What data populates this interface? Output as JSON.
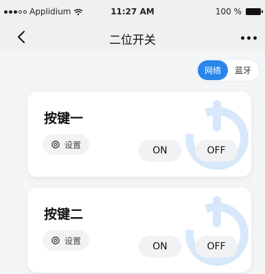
{
  "status_bar": {
    "carrier": "Applidium",
    "time": "11:27 AM",
    "battery_percent": "100 %"
  },
  "nav": {
    "title": "二位开关"
  },
  "toggle": {
    "network": "网络",
    "bluetooth": "蓝牙"
  },
  "cards": [
    {
      "title": "按键一",
      "settings_label": "设置",
      "on_label": "ON",
      "off_label": "OFF"
    },
    {
      "title": "按键二",
      "settings_label": "设置",
      "on_label": "ON",
      "off_label": "OFF"
    }
  ],
  "colors": {
    "accent": "#2a86ea",
    "background": "#f4f5f7",
    "card_bg": "#ffffff",
    "chip_bg": "#f1f2f4"
  },
  "icons": {
    "back": "chevron-left-icon",
    "more": "more-icon",
    "wifi": "wifi-icon",
    "battery": "battery-icon",
    "gear": "gear-icon",
    "power": "power-icon"
  }
}
